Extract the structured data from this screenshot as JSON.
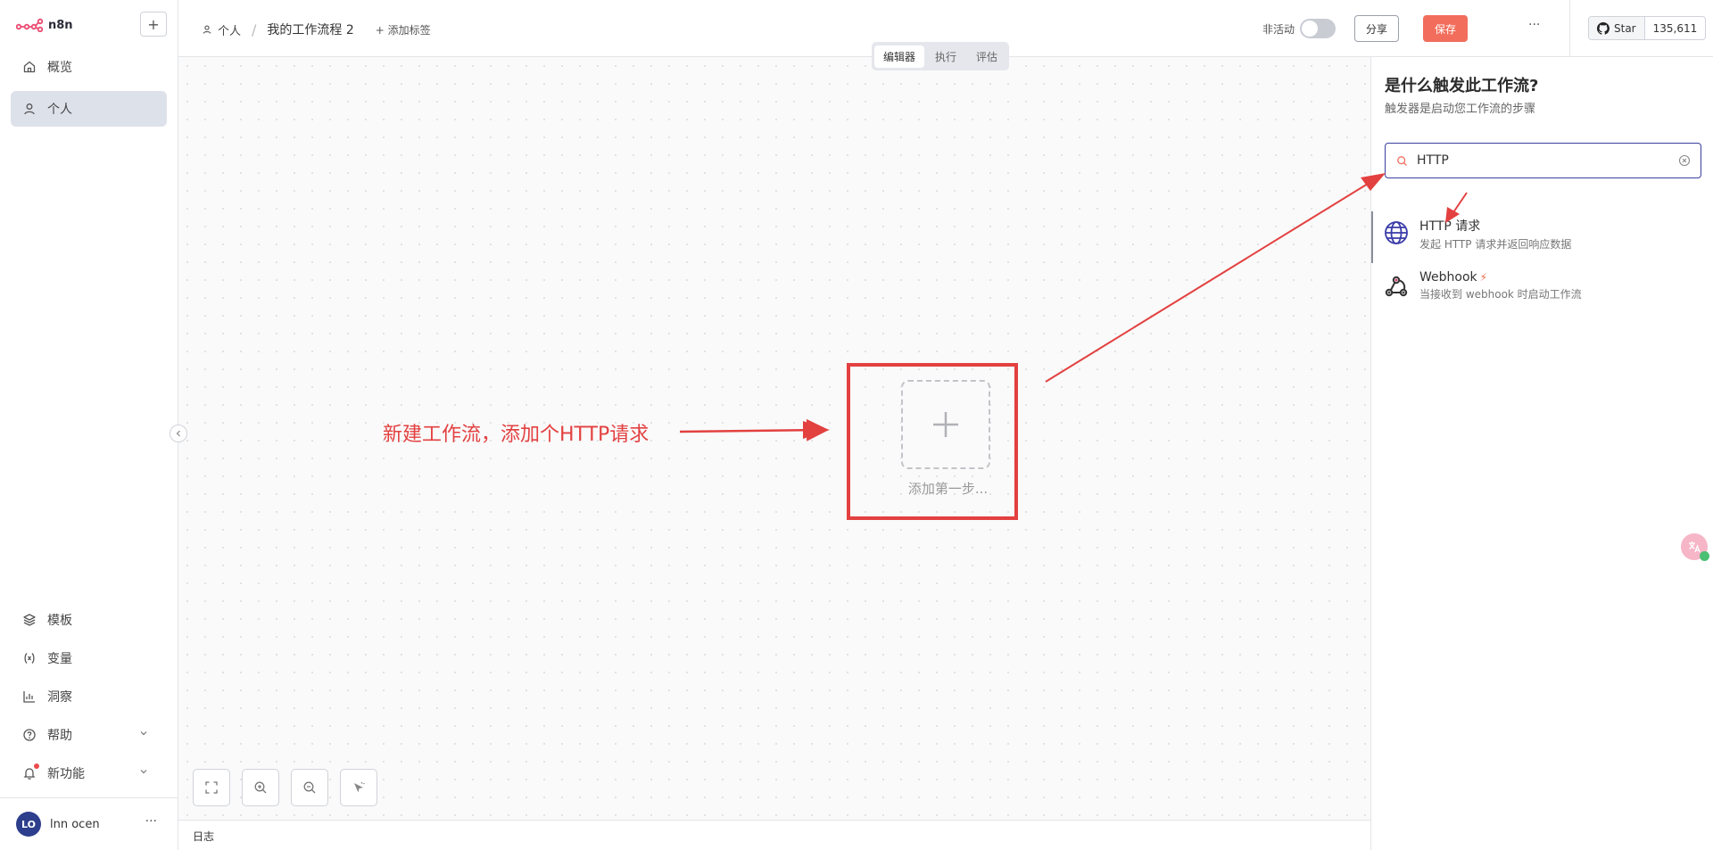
{
  "app": {
    "logo_text": "n8n"
  },
  "sidebar": {
    "add_label": "+",
    "top_items": [
      {
        "label": "概览",
        "icon": "home-icon"
      },
      {
        "label": "个人",
        "icon": "user-icon",
        "active": true
      }
    ],
    "bottom_items": [
      {
        "label": "模板",
        "icon": "templates-icon"
      },
      {
        "label": "变量",
        "icon": "variables-icon"
      },
      {
        "label": "洞察",
        "icon": "insights-icon"
      },
      {
        "label": "帮助",
        "icon": "help-icon"
      },
      {
        "label": "新功能",
        "icon": "bell-icon"
      }
    ],
    "user": {
      "initials": "LO",
      "name": "lnn ocen"
    }
  },
  "header": {
    "breadcrumb_owner": "个人",
    "separator": "/",
    "workflow_name": "我的工作流程 2",
    "add_tag": "+ 添加标签",
    "inactive_label": "非活动",
    "share_label": "分享",
    "save_label": "保存",
    "more_label": "···",
    "github": {
      "star_label": "Star",
      "star_count": "135,611"
    }
  },
  "canvas": {
    "tabs": [
      {
        "label": "编辑器",
        "active": true
      },
      {
        "label": "执行",
        "active": false
      },
      {
        "label": "评估",
        "active": false
      }
    ],
    "add_first_step": "添加第一步...",
    "annotation": "新建工作流，添加个HTTP请求",
    "tools": [
      "fit-view-icon",
      "zoom-in-icon",
      "zoom-out-icon",
      "tidy-up-icon"
    ]
  },
  "logbar": {
    "label": "日志"
  },
  "panel": {
    "title": "是什么触发此工作流?",
    "subtitle": "触发器是启动您工作流的步骤",
    "search": {
      "value": "HTTP",
      "placeholder": ""
    },
    "results": [
      {
        "name": "HTTP 请求",
        "desc": "发起 HTTP 请求并返回响应数据",
        "icon": "globe-icon"
      },
      {
        "name": "Webhook",
        "desc": "当接收到 webhook 时启动工作流",
        "icon": "webhook-icon"
      }
    ]
  },
  "colors": {
    "accent": "#f26d5b",
    "annotation": "#e34040",
    "brand": "#ea4b71"
  }
}
